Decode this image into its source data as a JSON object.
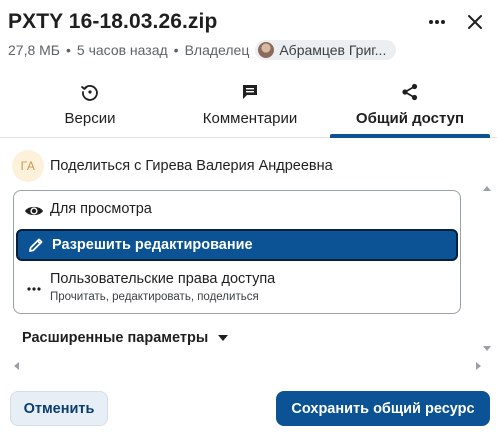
{
  "header": {
    "title": "PXTY 16-18.03.26.zip",
    "size": "27,8 МБ",
    "modified": "5 часов назад",
    "owner_label": "Владелец",
    "owner_name": "Абрамцев Григ...",
    "more_icon": "more-horizontal-icon",
    "close_icon": "close-icon"
  },
  "tabs": [
    {
      "label": "Версии",
      "icon": "history-icon",
      "active": false
    },
    {
      "label": "Комментарии",
      "icon": "comment-icon",
      "active": false
    },
    {
      "label": "Общий доступ",
      "icon": "share-icon",
      "active": true
    }
  ],
  "share": {
    "initials": "ГА",
    "text": "Поделиться с Гирева Валерия Андреевна"
  },
  "permissions": {
    "selected": "Разрешить редактирование",
    "options": [
      {
        "label": "Для просмотра",
        "icon": "eye-icon"
      },
      {
        "label": "Разрешить редактирование",
        "icon": "pencil-icon"
      },
      {
        "label": "Пользовательские права доступа",
        "sub": "Прочитать, редактировать, поделиться",
        "icon": "more-horizontal-icon"
      }
    ]
  },
  "advanced": {
    "label": "Расширенные параметры"
  },
  "footer": {
    "cancel_label": "Отменить",
    "save_label": "Сохранить общий ресурс"
  },
  "colors": {
    "accent": "#0b5394",
    "cancel_bg": "#e7eef5",
    "initials_bg": "#fdf1dc"
  }
}
